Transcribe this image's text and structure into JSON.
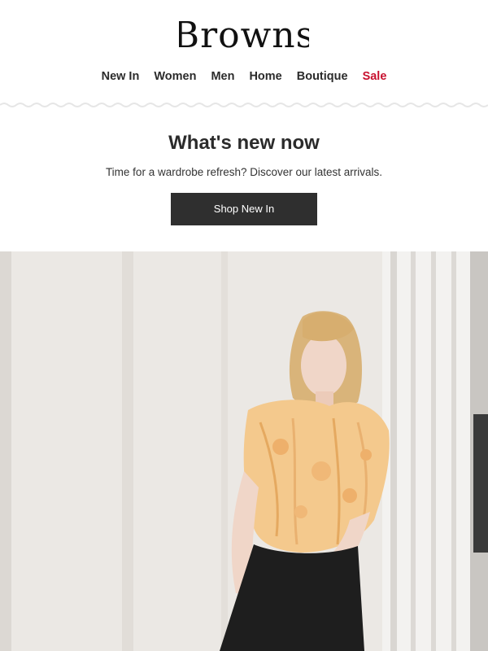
{
  "brand": {
    "logo_text": "Browns"
  },
  "nav": {
    "items": [
      {
        "label": "New In"
      },
      {
        "label": "Women"
      },
      {
        "label": "Men"
      },
      {
        "label": "Home"
      },
      {
        "label": "Boutique"
      },
      {
        "label": "Sale"
      }
    ]
  },
  "promo": {
    "title": "What's new now",
    "subtitle": "Time for a wardrobe refresh? Discover our latest arrivals.",
    "cta_label": "Shop New In"
  },
  "colors": {
    "text": "#2b2b2b",
    "sale": "#c8102e",
    "button_bg": "#2f2f2f",
    "button_text": "#ffffff"
  }
}
